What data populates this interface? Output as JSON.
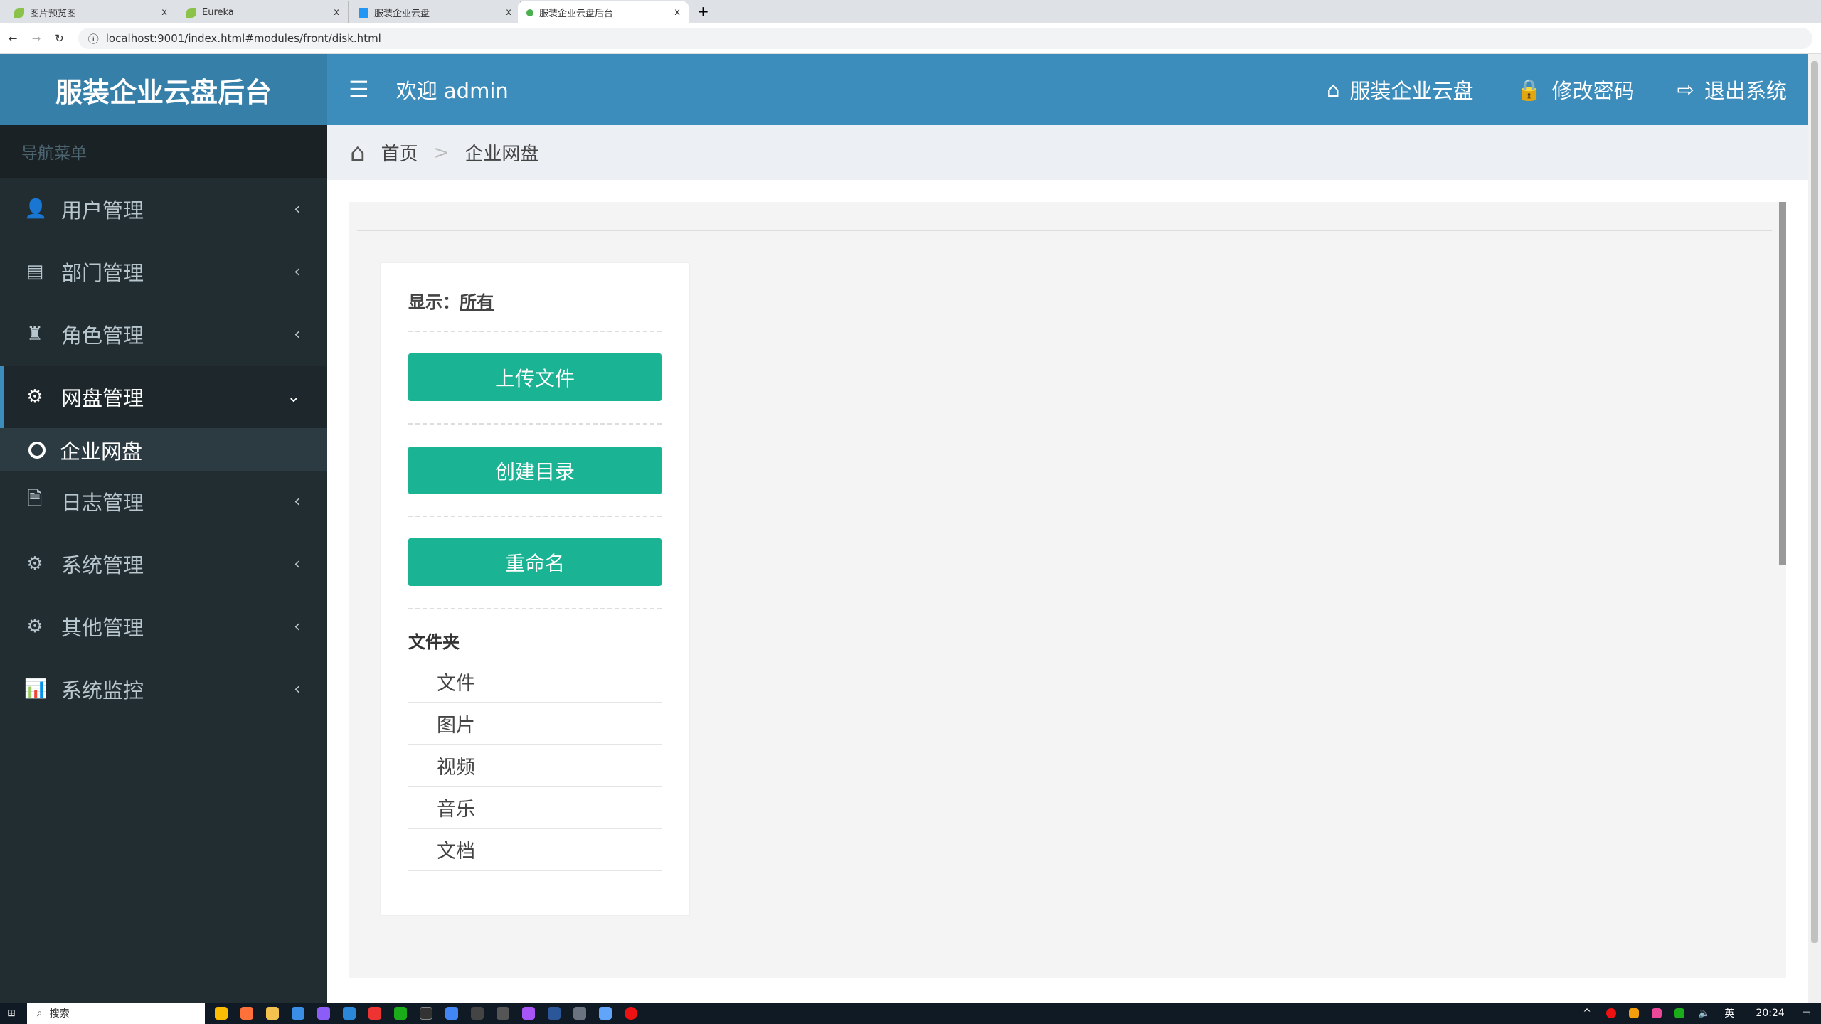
{
  "browser": {
    "tabs": [
      {
        "label": "图片预览图"
      },
      {
        "label": "Eureka"
      },
      {
        "label": "服装企业云盘"
      },
      {
        "label": "服装企业云盘后台",
        "active": true
      }
    ],
    "close": "x",
    "new_tab": "+",
    "url": "localhost:9001/index.html#modules/front/disk.html"
  },
  "sidebar": {
    "logo": "服装企业云盘后台",
    "nav_header": "导航菜单",
    "items": [
      {
        "label": "用户管理",
        "icon": "user-icon"
      },
      {
        "label": "部门管理",
        "icon": "id-card-icon"
      },
      {
        "label": "角色管理",
        "icon": "role-icon"
      },
      {
        "label": "网盘管理",
        "icon": "gear-icon",
        "expanded": true
      },
      {
        "label": "日志管理",
        "icon": "file-icon"
      },
      {
        "label": "系统管理",
        "icon": "gear-icon"
      },
      {
        "label": "其他管理",
        "icon": "gear-icon"
      },
      {
        "label": "系统监控",
        "icon": "bar-chart-icon"
      }
    ],
    "subitem": "企业网盘"
  },
  "header": {
    "welcome": "欢迎 admin",
    "links": [
      {
        "label": "服装企业云盘",
        "icon": "home-icon"
      },
      {
        "label": "修改密码",
        "icon": "lock-icon"
      },
      {
        "label": "退出系统",
        "icon": "sign-out-icon"
      }
    ]
  },
  "breadcrumb": {
    "home": "首页",
    "sep": ">",
    "current": "企业网盘"
  },
  "card": {
    "show_label": "显示：",
    "show_value": "所有",
    "buttons": [
      "上传文件",
      "创建目录",
      "重命名"
    ],
    "folder_title": "文件夹",
    "folders": [
      "文件",
      "图片",
      "视频",
      "音乐",
      "文档"
    ]
  },
  "taskbar": {
    "search": "搜索",
    "ime": "英",
    "time": "20:24"
  },
  "colors": {
    "header": "#3c8dbc",
    "sidebar": "#222d32",
    "button": "#1ab394"
  }
}
